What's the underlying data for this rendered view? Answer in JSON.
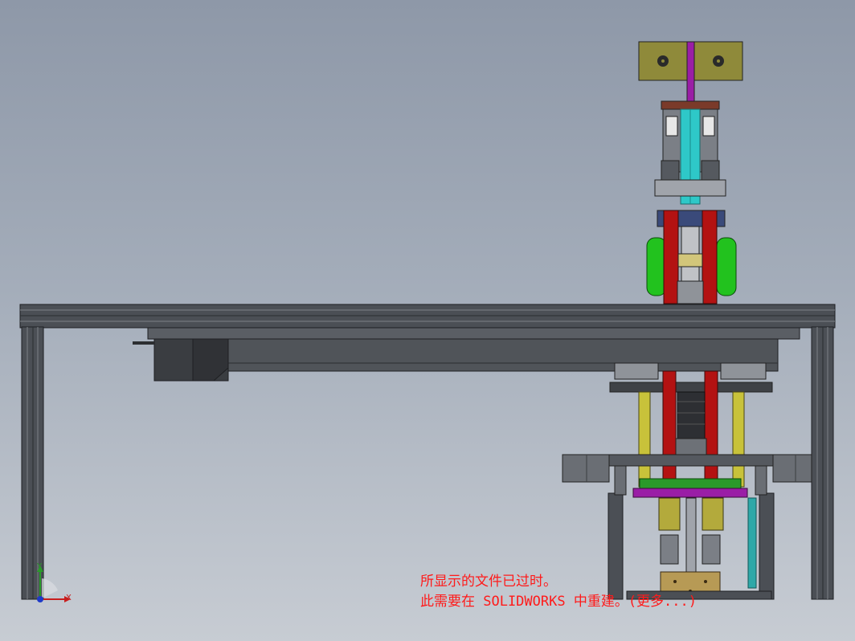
{
  "triad": {
    "x_label": "X",
    "y_label": "Y"
  },
  "notice": {
    "line1": "所显示的文件已过时。",
    "line2": "此需要在 SOLIDWORKS 中重建。(更多...)"
  },
  "colors": {
    "background_top": "#8e98a8",
    "background_bottom": "#c7ccd3",
    "frame": "#4a4e54",
    "notice_text": "#ff1a1a",
    "motor_plate": "#8f8a3a",
    "green_wheel": "#22c21e",
    "red_link": "#b31212",
    "cyan_rod": "#2ec8c8",
    "purple_bar": "#9a1ea6",
    "yellow_rod": "#c8c23a"
  }
}
